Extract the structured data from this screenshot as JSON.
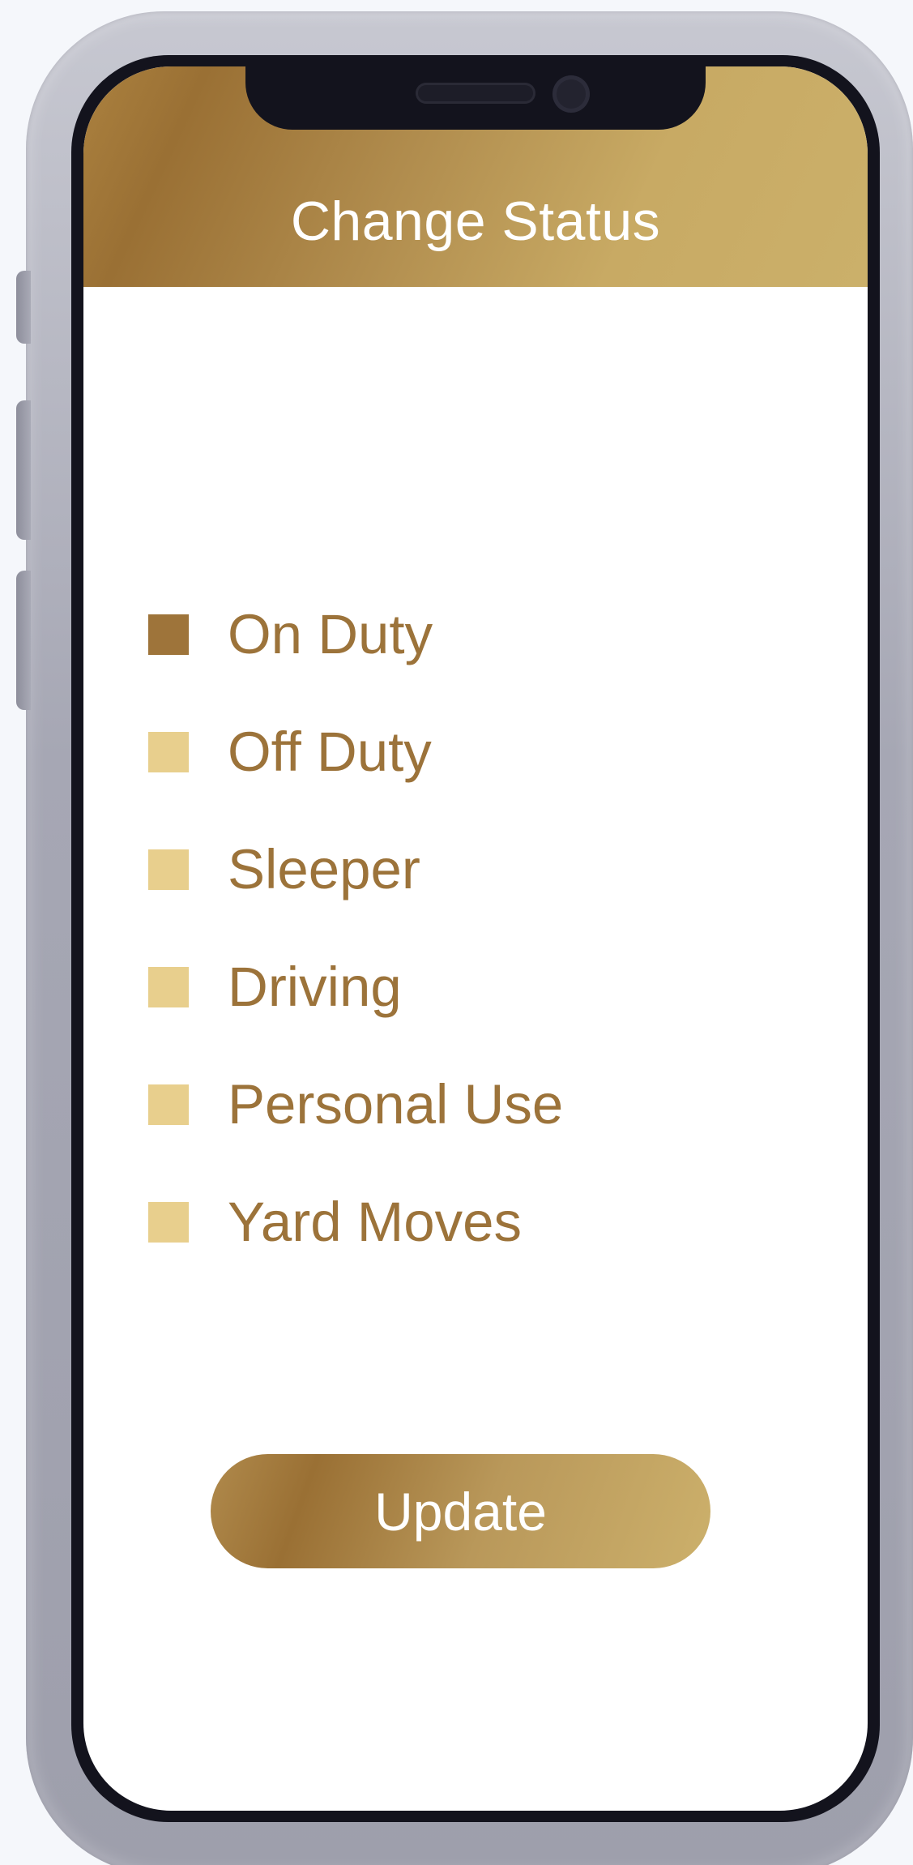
{
  "header": {
    "title": "Change Status"
  },
  "statuses": [
    {
      "label": "On Duty",
      "selected": true
    },
    {
      "label": "Off Duty",
      "selected": false
    },
    {
      "label": "Sleeper",
      "selected": false
    },
    {
      "label": "Driving",
      "selected": false
    },
    {
      "label": "Personal Use",
      "selected": false
    },
    {
      "label": "Yard Moves",
      "selected": false
    }
  ],
  "update_button": {
    "label": "Update"
  },
  "colors": {
    "accent_dark": "#9e743a",
    "accent_light": "#e8cf8d",
    "label_text": "#9c733a",
    "header_gradient_start": "#9a7034",
    "header_gradient_end": "#cbb06a"
  }
}
